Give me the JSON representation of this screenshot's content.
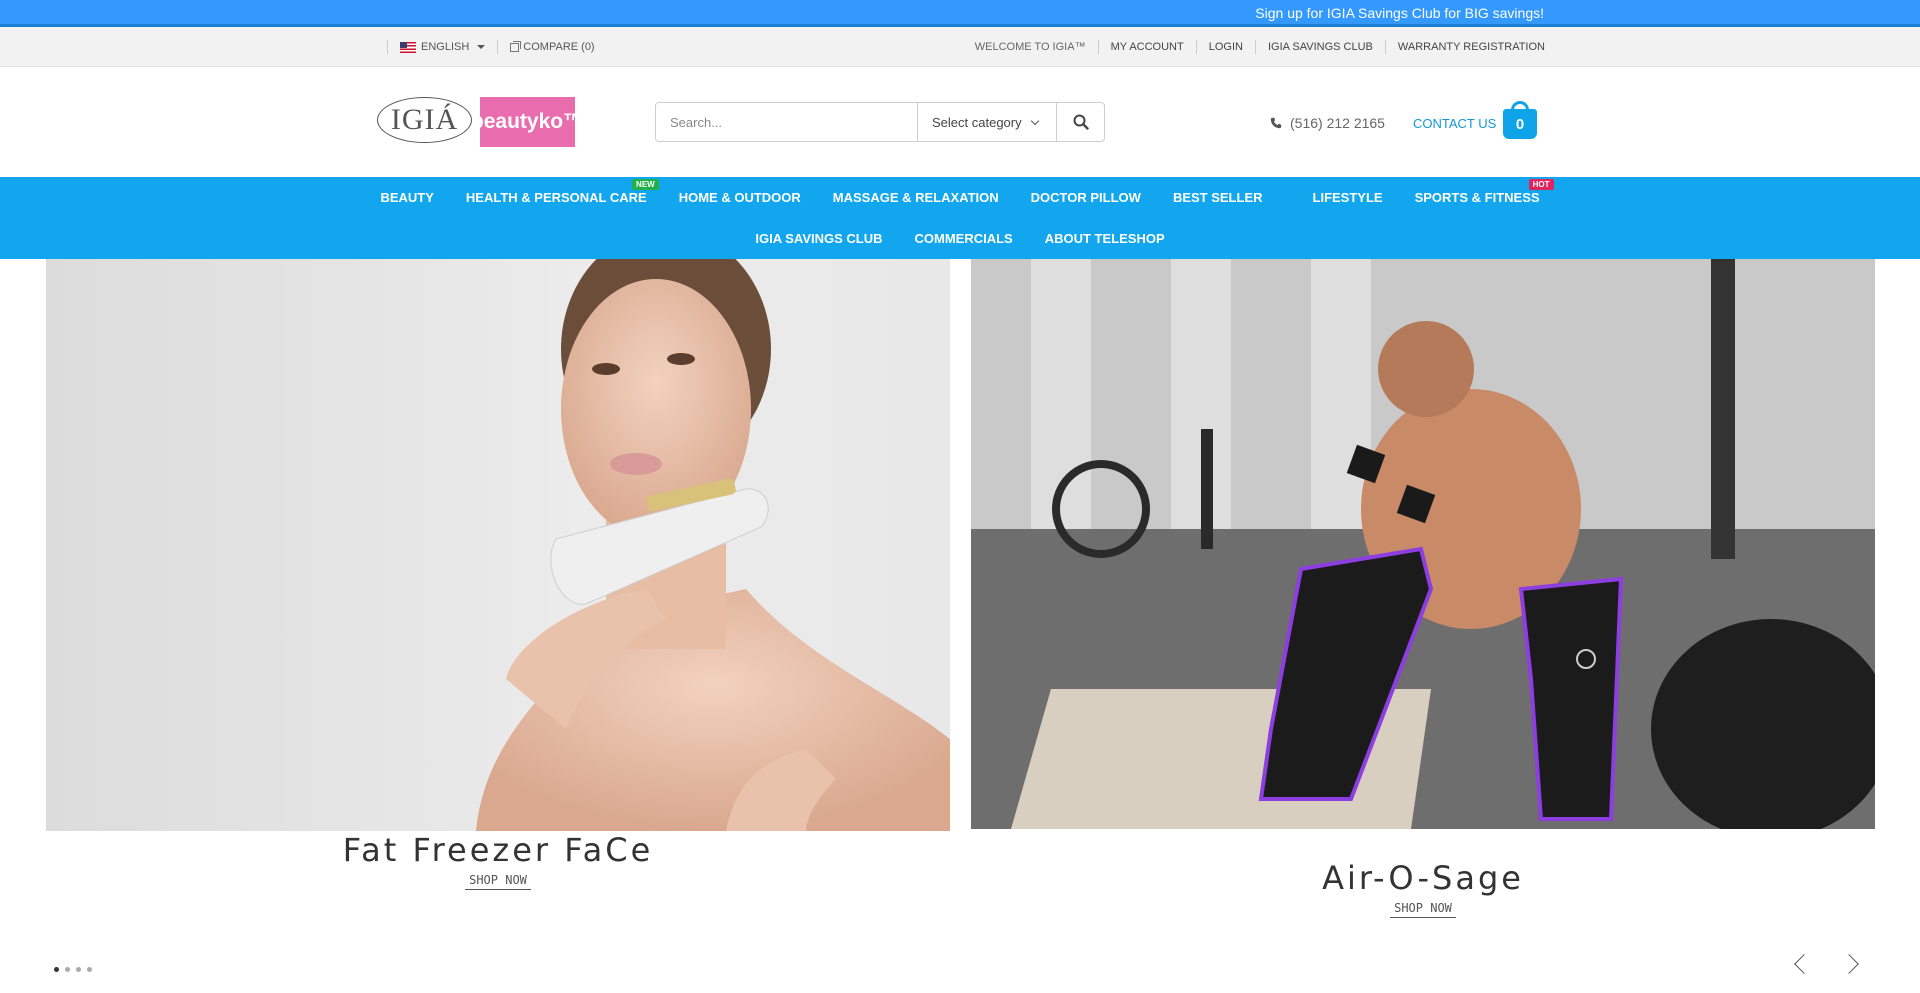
{
  "promo": {
    "text": "Sign up for IGIA Savings Club for BIG savings!"
  },
  "topbar": {
    "language": "ENGLISH",
    "compare": "COMPARE (0)",
    "links": [
      "WELCOME TO IGIA™",
      "MY ACCOUNT",
      "LOGIN",
      "IGIA SAVINGS CLUB",
      "WARRANTY REGISTRATION"
    ]
  },
  "header": {
    "logo_igia": "IGIÁ",
    "logo_beautyko": "beautyko™",
    "search": {
      "placeholder": "Search...",
      "category": "Select category"
    },
    "phone": "(516) 212 2165",
    "contact": "CONTACT US",
    "cart_count": "0"
  },
  "nav": {
    "row1": [
      {
        "label": "BEAUTY",
        "badge": ""
      },
      {
        "label": "HEALTH & PERSONAL CARE",
        "badge": "NEW"
      },
      {
        "label": "HOME & OUTDOOR",
        "badge": ""
      },
      {
        "label": "MASSAGE & RELAXATION",
        "badge": ""
      },
      {
        "label": "DOCTOR PILLOW",
        "badge": ""
      },
      {
        "label": "BEST SELLER",
        "badge": ""
      },
      {
        "label": "LIFESTYLE",
        "badge": ""
      },
      {
        "label": "SPORTS & FITNESS",
        "badge": "HOT"
      }
    ],
    "row2": [
      {
        "label": "IGIA SAVINGS CLUB"
      },
      {
        "label": "COMMERCIALS"
      },
      {
        "label": "ABOUT TELESHOP"
      }
    ]
  },
  "slides": [
    {
      "title": "Fat Freezer FaCe",
      "cta": "SHOP NOW"
    },
    {
      "title": "Air-O-Sage",
      "cta": "SHOP NOW"
    }
  ],
  "carousel": {
    "dots": 4,
    "active_dot": 1
  }
}
